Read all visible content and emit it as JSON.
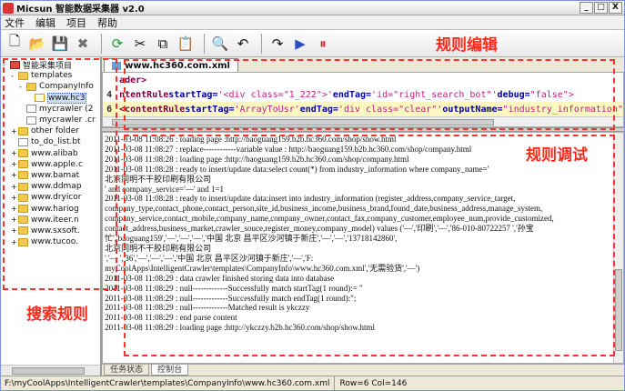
{
  "window": {
    "title": "Micsun 智能数据采集器 v2.0",
    "controls": [
      "_",
      "□",
      "X"
    ]
  },
  "menu": [
    "文件",
    "编辑",
    "项目",
    "帮助"
  ],
  "toolbar": [
    {
      "icon": "new-file-icon",
      "glyph": "🗋"
    },
    {
      "icon": "open-folder-icon",
      "glyph": "📂"
    },
    {
      "icon": "save-icon",
      "glyph": "💾"
    },
    {
      "icon": "delete-icon",
      "glyph": "✖"
    },
    {
      "icon": "refresh-icon",
      "glyph": "⟳"
    },
    {
      "icon": "cut-icon",
      "glyph": "✂"
    },
    {
      "icon": "copy-icon",
      "glyph": "⧉"
    },
    {
      "icon": "paste-icon",
      "glyph": "📋"
    },
    {
      "icon": "find-icon",
      "glyph": "🔍"
    },
    {
      "icon": "undo-icon",
      "glyph": "↶"
    },
    {
      "icon": "redo-icon",
      "glyph": "↷"
    },
    {
      "icon": "run-icon",
      "glyph": "▶"
    },
    {
      "icon": "stop-icon",
      "glyph": "⏸"
    }
  ],
  "tree": [
    {
      "label": "智能采集项目",
      "type": "root",
      "indent": 0,
      "toggle": "-"
    },
    {
      "label": "templates",
      "type": "folder",
      "indent": 1,
      "toggle": "-"
    },
    {
      "label": "CompanyInfo",
      "type": "folder",
      "indent": 2,
      "toggle": "-"
    },
    {
      "label": "www.hc3",
      "type": "xml",
      "indent": 3,
      "toggle": "",
      "selected": true
    },
    {
      "label": "mycrawler (2",
      "type": "file",
      "indent": 2,
      "toggle": ""
    },
    {
      "label": "mycrawler .cr",
      "type": "file",
      "indent": 2,
      "toggle": ""
    },
    {
      "label": "other folder",
      "type": "folder",
      "indent": 1,
      "toggle": "+"
    },
    {
      "label": "to_do_list.bt",
      "type": "file",
      "indent": 1,
      "toggle": ""
    },
    {
      "label": "www.alibab",
      "type": "folder",
      "indent": 1,
      "toggle": "+"
    },
    {
      "label": "www.apple.c",
      "type": "folder",
      "indent": 1,
      "toggle": "+"
    },
    {
      "label": "www.bamat",
      "type": "folder",
      "indent": 1,
      "toggle": "+"
    },
    {
      "label": "www.ddmap",
      "type": "folder",
      "indent": 1,
      "toggle": "+"
    },
    {
      "label": "www.dryicor",
      "type": "folder",
      "indent": 1,
      "toggle": "+"
    },
    {
      "label": "www.hariog",
      "type": "folder",
      "indent": 1,
      "toggle": "+"
    },
    {
      "label": "www.iteer.n",
      "type": "folder",
      "indent": 1,
      "toggle": "+"
    },
    {
      "label": "www.sxsoft.",
      "type": "folder",
      "indent": 1,
      "toggle": "+"
    },
    {
      "label": "www.tucoo.",
      "type": "folder",
      "indent": 1,
      "toggle": "+"
    }
  ],
  "editor": {
    "tab": "www.hc360.com.xml",
    "lines": [
      {
        "num": "",
        "parts": [
          [
            "kw",
            "ader>"
          ]
        ]
      },
      {
        "num": "4",
        "parts": [
          [
            "kw",
            "ntentRule "
          ],
          [
            "attr",
            "startTag="
          ],
          [
            "str",
            "'&lt;div class=\"1_222\"&gt;' "
          ],
          [
            "attr",
            "endTag="
          ],
          [
            "str",
            "'id=\"right_search_bot\"' "
          ],
          [
            "attr",
            "debug="
          ],
          [
            "str",
            "\"false\">"
          ]
        ]
      },
      {
        "num": "6",
        "parts": [
          [
            "kw",
            "<contentRule "
          ],
          [
            "attr",
            "startTag="
          ],
          [
            "str",
            "'ArrayToUsr' "
          ],
          [
            "attr",
            "endTag="
          ],
          [
            "str",
            "'div class=\"clear\"' "
          ],
          [
            "attr",
            "outputName="
          ],
          [
            "str",
            "\"industry_information\""
          ]
        ],
        "current": true
      }
    ]
  },
  "log": [
    "2011-03-08 11:08:26 : loading page :http://baoguang159.b2b.hc360.com/shop/show.html",
    "2011-03-08 11:08:27 : replace------------variable value : http://baoguang159.b2b.hc360.com/shop/company.html",
    "2011-03-08 11:08:28 : loading page :http://baoguang159.b2b.hc360.com/shop/company.html",
    "2011-03-08 11:08:28 : ready to insert/update data:select count(*) from industry_information where company_name='",
    "                                北京同明不干胶印刷有限公司",
    "                                ' and company_service='—'  and  1=1",
    "2011-03-08 11:08:28 : ready to insert/update data:insert into industry_information (register_address,company_service_target,",
    "company_type,contact_phone,contact_person,site_id,business_income,business_brand,found_date,business_address,manage_system,",
    "company_service,contact_mobile,company_name,company_owner,contact_fax,company_customer,employee_num,provide_customized,",
    "contact_address,business_market,crawler_souce,register_money,company_model) values ('—','印刷','—','86-010-80722257 ','孙宝",
    "忙','baoguang159','—','—','—','中国 北京 昌平区沙河镇于新庄','—','—','13718142860',",
    "                                北京同明不干胶印刷有限公司",
    "                              ','—              ','36','—','—','—','中国 北京 昌平区沙河镇于新庄','—','F:",
    "myCoolApps\\IntelligentCrawler\\templates\\CompanyInfo\\www.hc360.com.xml','无需验货','—')",
    "2011-03-08 11:08:29 : data crawler finished storing data into database",
    "2011-03-08 11:08:29 : null-------------Successfully match startTag(1 round):= \"",
    "2011-03-08 11:08:29 : null-------------Successfully match endTag(1 round):\";",
    "2011-03-08 11:08:29 : null-------------Matched result is ykczzy",
    "2011-03-08 11:08:29 : end parse content",
    "2011-03-08 11:08:29 : loading page :http://ykczzy.b2b.hc360.com/shop/show.html"
  ],
  "bottom_tabs": [
    "任务状态",
    "控制台"
  ],
  "status": {
    "path": "F:\\myCoolApps\\IntelligentCrawler\\templates\\CompanyInfo\\www.hc360.com.xml",
    "position": "Row=6 Col=146"
  },
  "annotations": {
    "rule_edit": "规则编辑",
    "rule_debug": "规则调试",
    "search_rule": "搜索规则"
  },
  "colors": {
    "annotation": "#ff2a1a",
    "current_line": "#fdf7c0"
  }
}
